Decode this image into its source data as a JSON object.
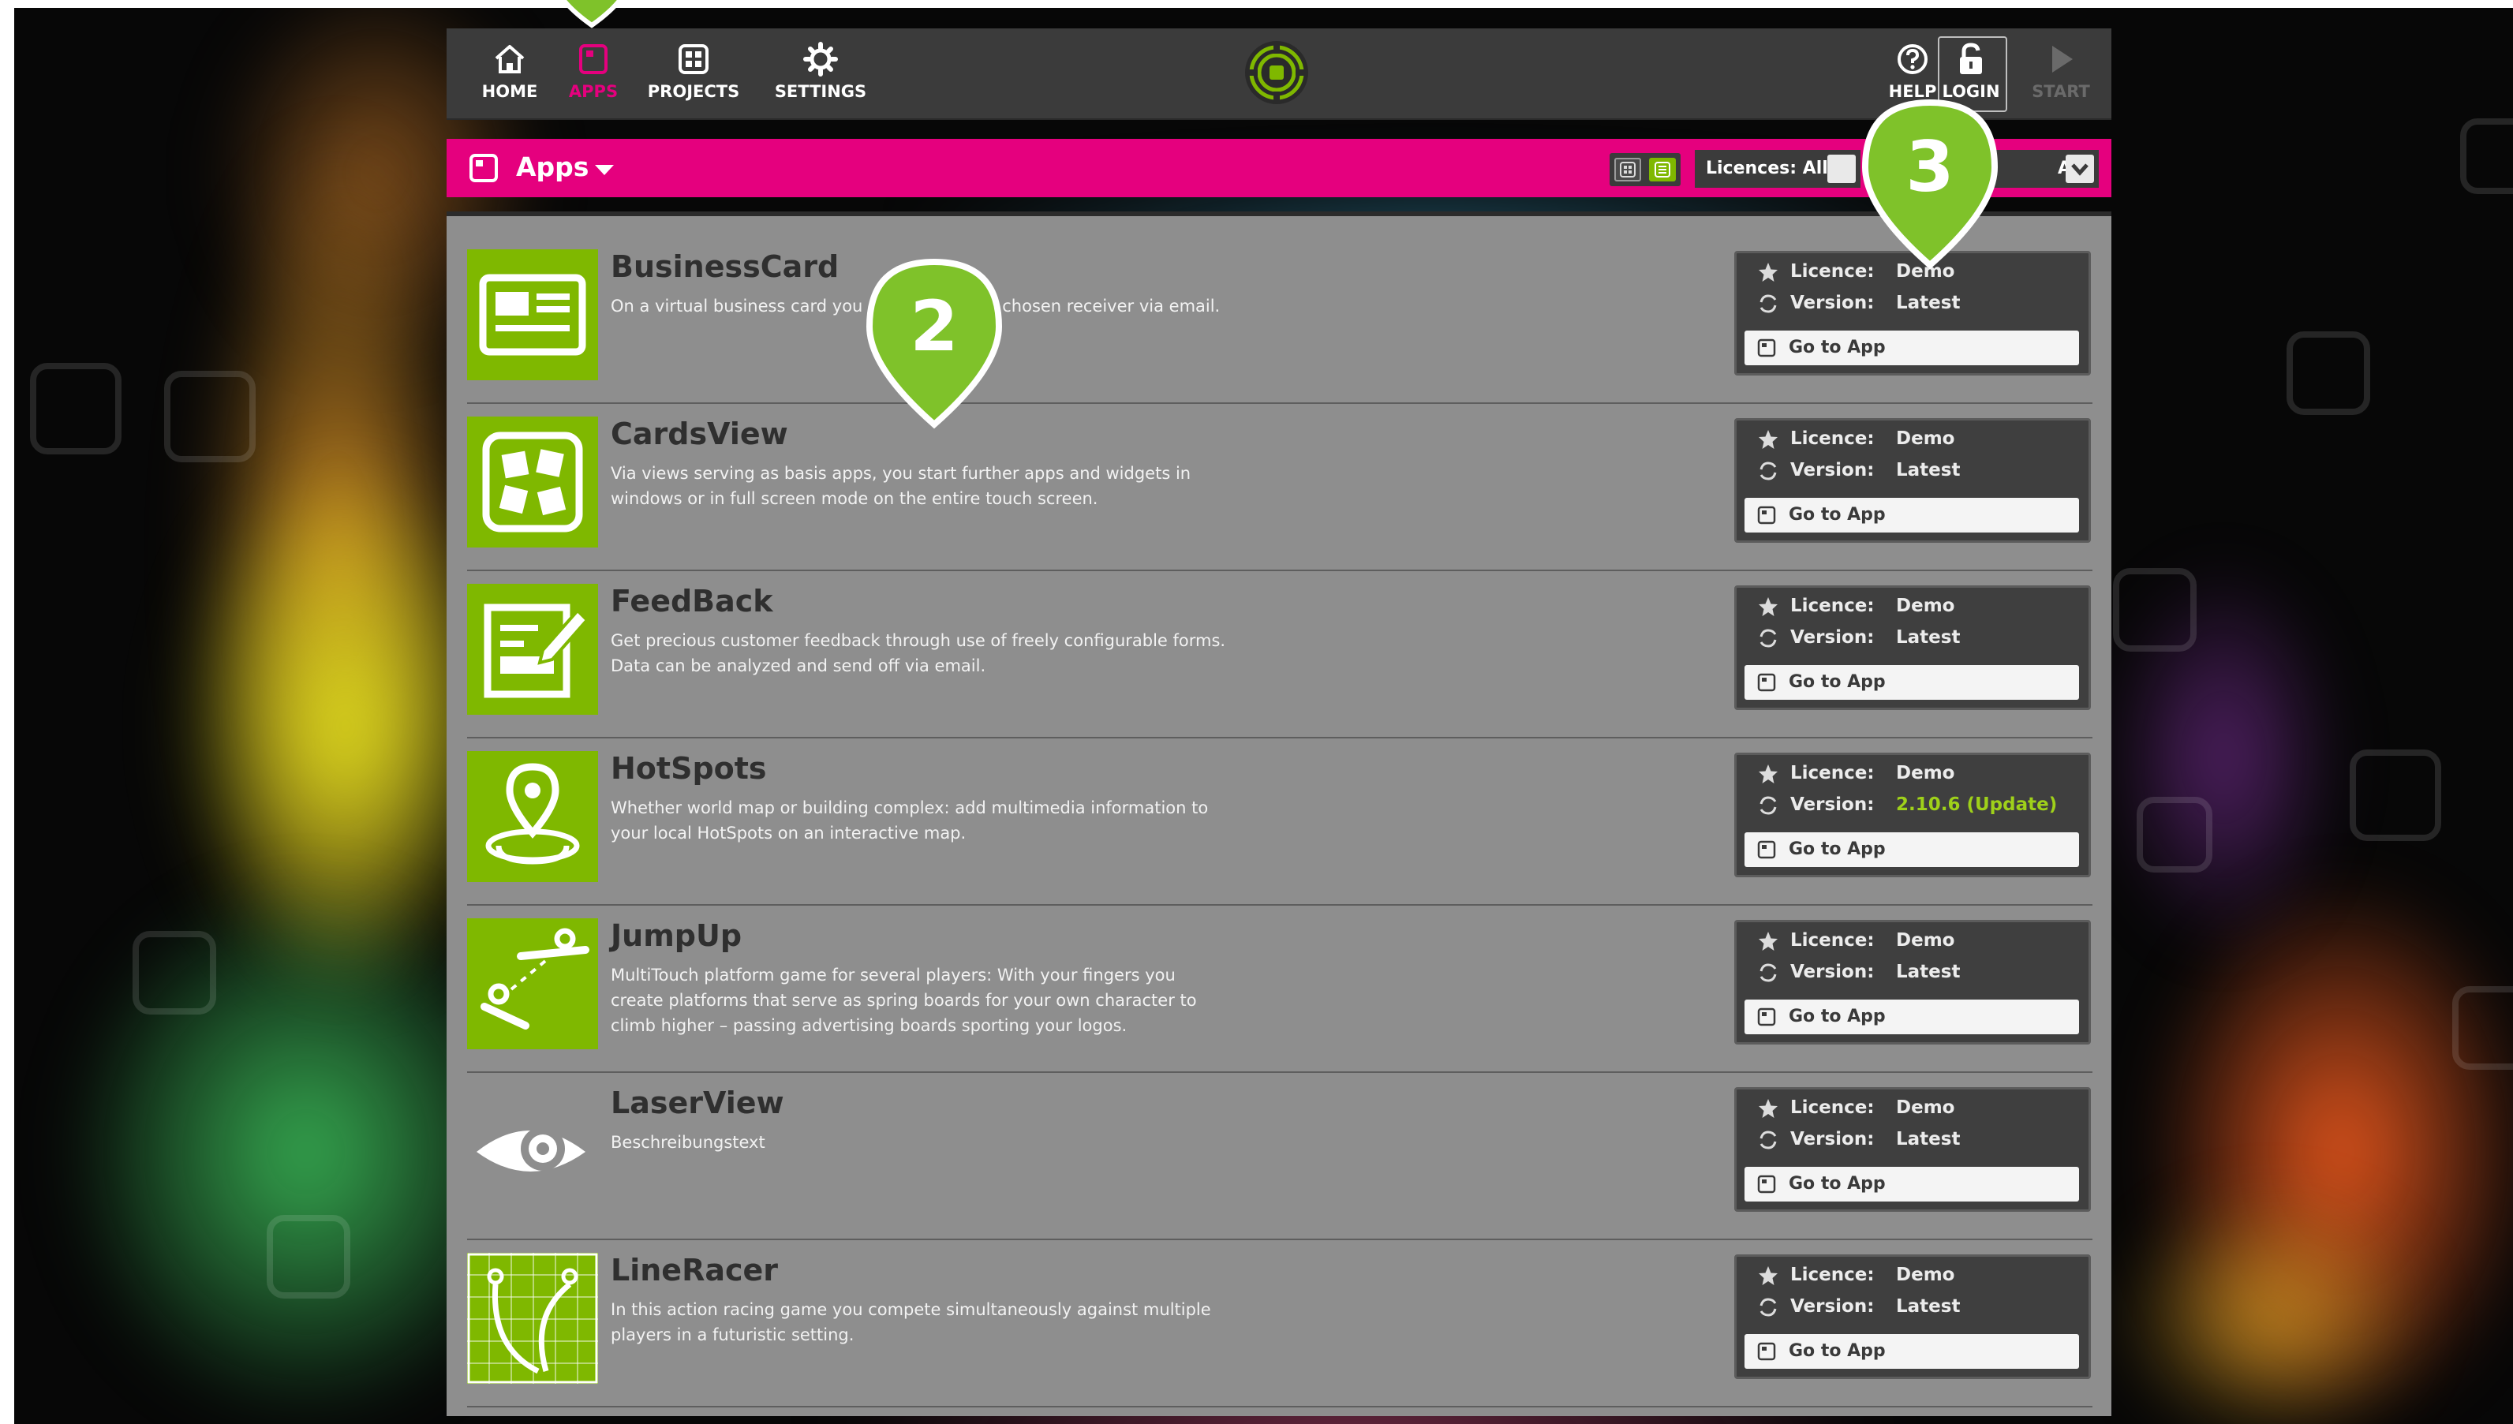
{
  "nav": {
    "home": "HOME",
    "apps": "APPS",
    "projects": "PROJECTS",
    "settings": "SETTINGS",
    "help": "HELP",
    "login": "LOGIN",
    "start": "START"
  },
  "subbar": {
    "title": "Apps",
    "licences_filter": "Licences: All",
    "second_filter": "All"
  },
  "labels": {
    "licence": "Licence:",
    "version": "Version:",
    "go_to_app": "Go to App"
  },
  "apps": [
    {
      "name": "BusinessCard",
      "desc": "On a virtual business card you ma         nd files to a chosen receiver via email.",
      "licence": "Demo",
      "version": "Latest",
      "icon": "business-card-icon"
    },
    {
      "name": "CardsView",
      "desc": "Via views serving as basis apps, you start further apps and widgets in windows or in full screen mode on the entire touch screen.",
      "licence": "Demo",
      "version": "Latest",
      "icon": "cards-view-icon"
    },
    {
      "name": "FeedBack",
      "desc": "Get precious customer feedback through use of freely configurable forms. Data can be analyzed and send off via email.",
      "licence": "Demo",
      "version": "Latest",
      "icon": "feedback-form-icon"
    },
    {
      "name": "HotSpots",
      "desc": "Whether world map or building complex: add multimedia information to your local HotSpots on an interactive map.",
      "licence": "Demo",
      "version": "2.10.6 (Update)",
      "icon": "map-pin-icon"
    },
    {
      "name": "JumpUp",
      "desc": "MultiTouch platform game for several players: With your fingers you create platforms that serve as spring boards for your own character to climb higher – passing advertising boards sporting your logos.",
      "licence": "Demo",
      "version": "Latest",
      "icon": "jump-platform-icon"
    },
    {
      "name": "LaserView",
      "desc": "Beschreibungstext",
      "licence": "Demo",
      "version": "Latest",
      "icon": "eye-icon"
    },
    {
      "name": "LineRacer",
      "desc": "In this action racing game you compete simultaneously against multiple players in a futuristic setting.",
      "licence": "Demo",
      "version": "Latest",
      "icon": "race-track-icon"
    }
  ],
  "markers": {
    "m2": "2",
    "m3": "3"
  },
  "colors": {
    "accent": "#e5007e",
    "app_green": "#7fb800",
    "update_green": "#9fd11a",
    "bar": "#3b3b3b"
  }
}
